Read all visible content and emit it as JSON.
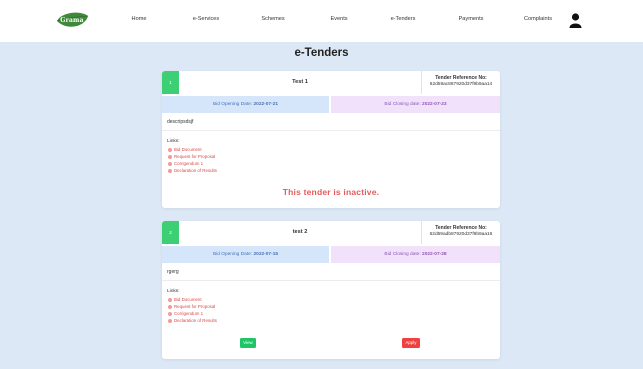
{
  "nav": {
    "logo_text": "Grama",
    "items": [
      "Home",
      "e-Services",
      "Schemes",
      "Events",
      "e-Tenders",
      "Payments",
      "Complaints"
    ]
  },
  "page": {
    "title": "e-Tenders"
  },
  "tenders": [
    {
      "number": "1",
      "title": "Test 1",
      "ref_label": "Tender Reference No:",
      "ref_value": "62d59ac887920d37f9b9aa14",
      "opening_label": "Bid Opening Date:",
      "opening_date": "2022-07-21",
      "closing_label": "Bid Closing date:",
      "closing_date": "2022-07-23",
      "description": "descripsdsjf",
      "links_label": "Links:",
      "links": [
        "Bid Document",
        "Request for Proposal",
        "Corrigendum 1",
        "Declaration of Results"
      ],
      "status_message": "This tender is inactive."
    },
    {
      "number": "2",
      "title": "test 2",
      "ref_label": "Tender Reference No:",
      "ref_value": "62d59adb87920d37f9b9aa16",
      "opening_label": "Bid Opening Date:",
      "opening_date": "2022-07-15",
      "closing_label": "Bid Closing date:",
      "closing_date": "2022-07-28",
      "description": "rgerg",
      "links_label": "Links:",
      "links": [
        "Bid Document",
        "Request for Proposal",
        "Corrigendum 1",
        "Declaration of Results"
      ],
      "view_label": "View",
      "apply_label": "Apply"
    }
  ],
  "colors": {
    "accent_green": "#3dcf74",
    "danger_red": "#f04141",
    "page_bg": "#dde8f6",
    "open_date_bg": "#d5e6fb",
    "close_date_bg": "#f2e1fa"
  },
  "icons": {
    "logo": "grama-leaf-logo",
    "user": "user-profile-icon",
    "link_bullet": "bullet-dot-icon"
  }
}
